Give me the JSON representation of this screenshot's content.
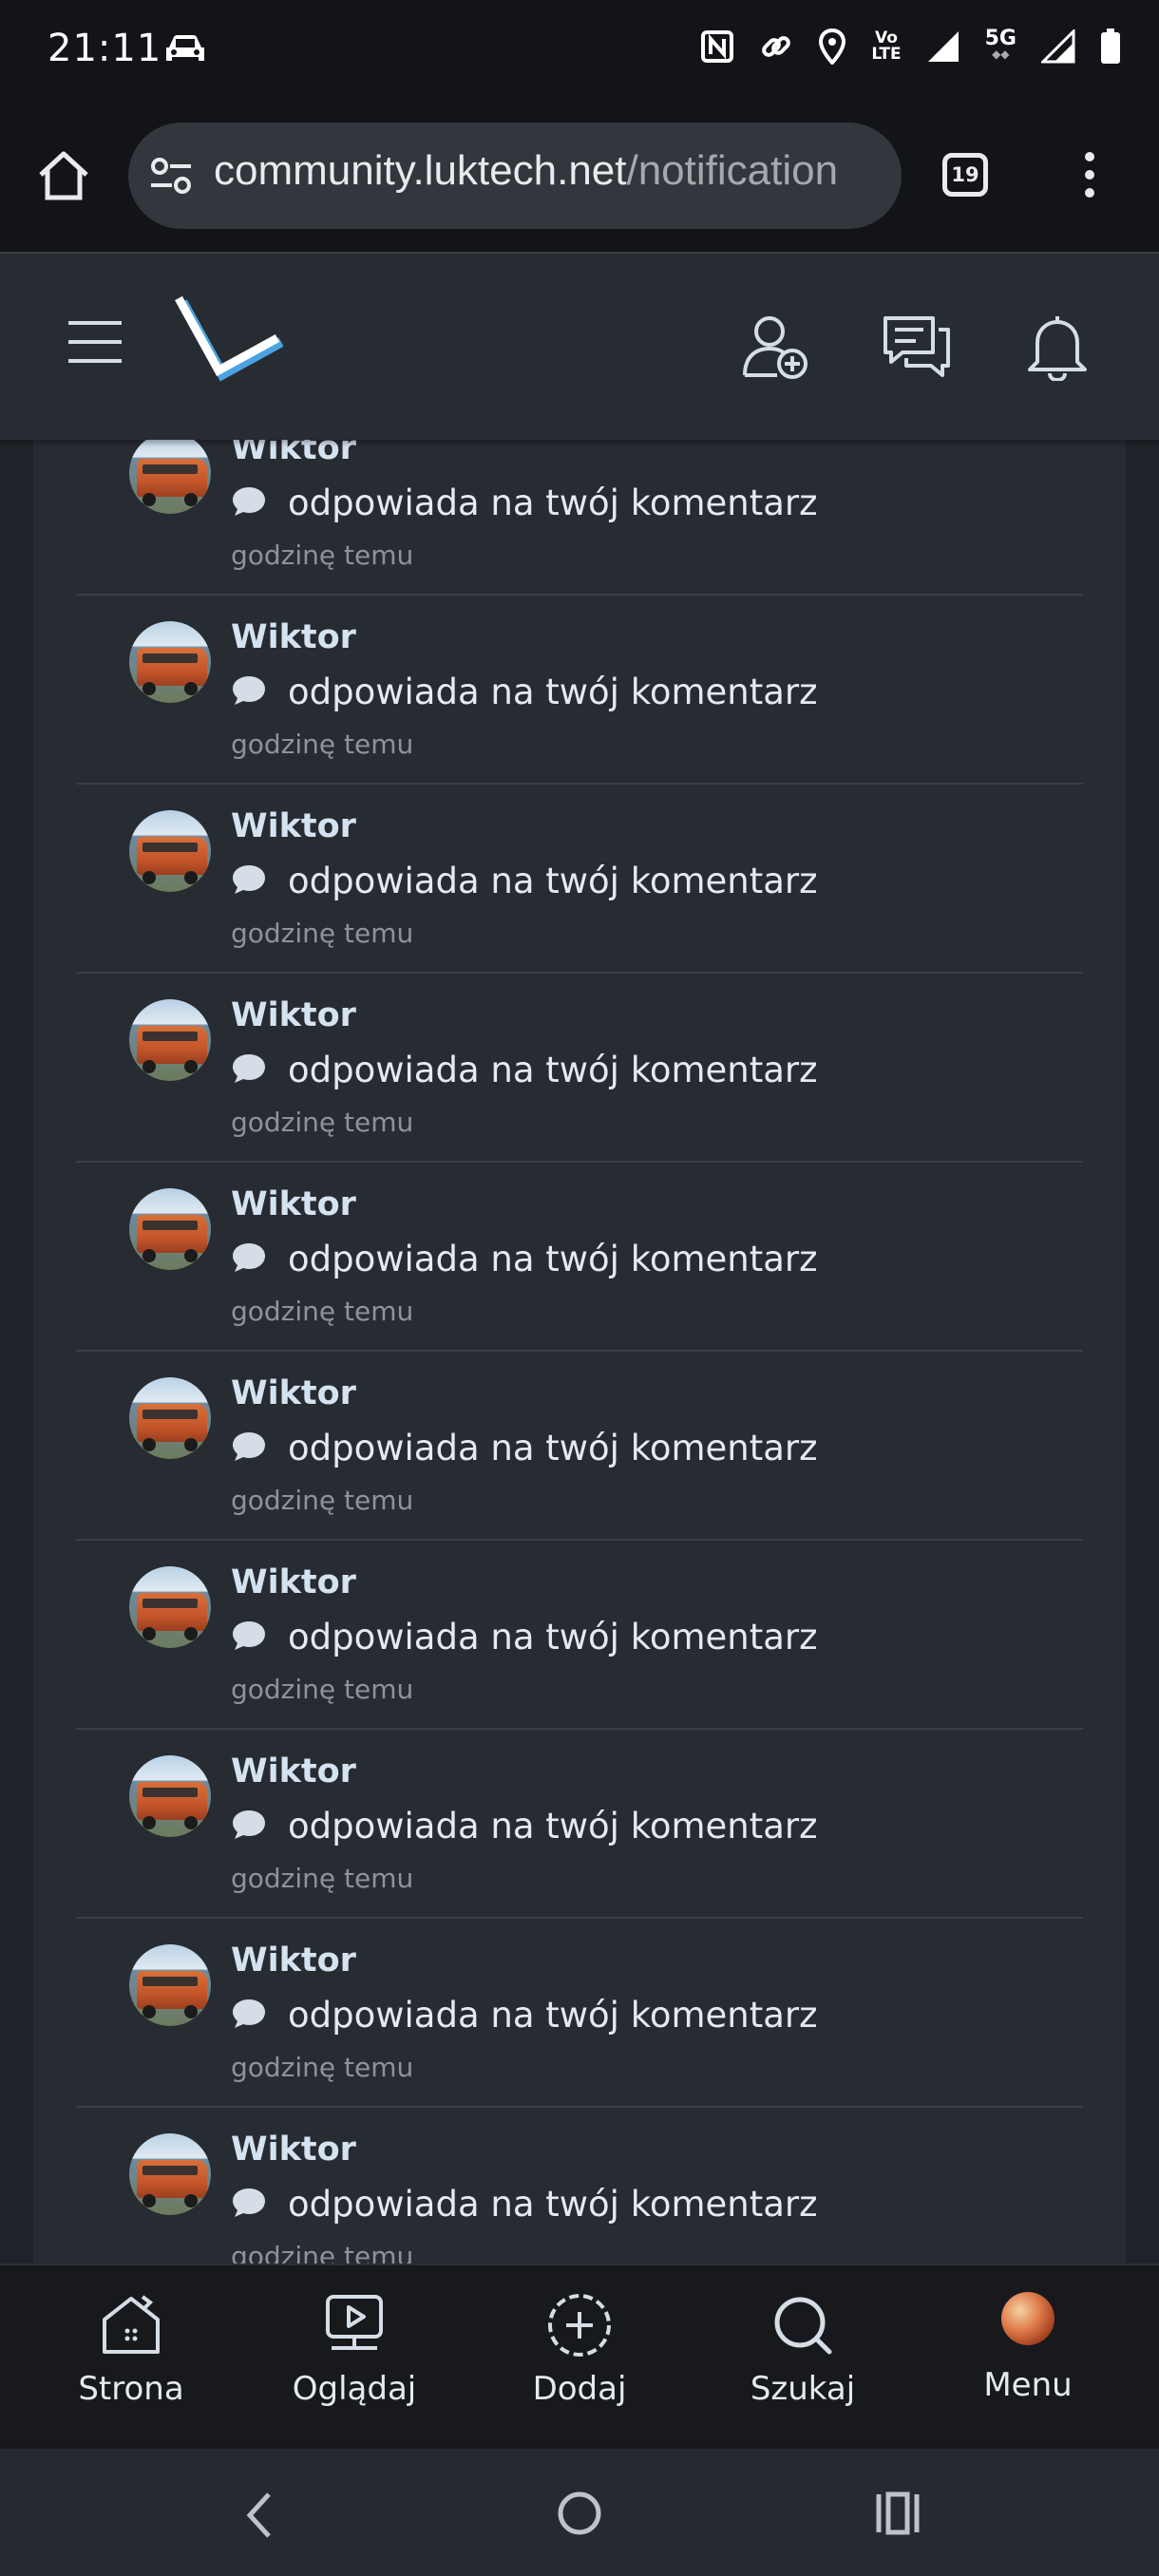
{
  "status_bar": {
    "time": "21:11",
    "network_label": "5G",
    "volte_label_top": "Vo",
    "volte_label_bottom": "LTE",
    "icons": [
      "car-icon",
      "nfc-icon",
      "link-icon",
      "location-icon",
      "volte-icon",
      "signal-icon",
      "battery-icon"
    ]
  },
  "browser": {
    "url_host": "community.luktech.net",
    "url_path": "/notification",
    "tab_count": "19"
  },
  "site_header": {
    "logo_letter": "L",
    "icons": [
      "hamburger-icon",
      "add-friend-icon",
      "messages-icon",
      "bell-icon"
    ]
  },
  "notifications": [
    {
      "user": "Wiktor",
      "action": "odpowiada na twój komentarz",
      "time": "godzinę temu"
    },
    {
      "user": "Wiktor",
      "action": "odpowiada na twój komentarz",
      "time": "godzinę temu"
    },
    {
      "user": "Wiktor",
      "action": "odpowiada na twój komentarz",
      "time": "godzinę temu"
    },
    {
      "user": "Wiktor",
      "action": "odpowiada na twój komentarz",
      "time": "godzinę temu"
    },
    {
      "user": "Wiktor",
      "action": "odpowiada na twój komentarz",
      "time": "godzinę temu"
    },
    {
      "user": "Wiktor",
      "action": "odpowiada na twój komentarz",
      "time": "godzinę temu"
    },
    {
      "user": "Wiktor",
      "action": "odpowiada na twój komentarz",
      "time": "godzinę temu"
    },
    {
      "user": "Wiktor",
      "action": "odpowiada na twój komentarz",
      "time": "godzinę temu"
    },
    {
      "user": "Wiktor",
      "action": "odpowiada na twój komentarz",
      "time": "godzinę temu"
    },
    {
      "user": "Wiktor",
      "action": "odpowiada na twój komentarz",
      "time": "godzinę temu"
    }
  ],
  "bottom_nav": [
    {
      "label": "Strona",
      "icon": "home-icon"
    },
    {
      "label": "Oglądaj",
      "icon": "watch-icon"
    },
    {
      "label": "Dodaj",
      "icon": "add-icon"
    },
    {
      "label": "Szukaj",
      "icon": "search-icon"
    },
    {
      "label": "Menu",
      "icon": "menu-avatar"
    }
  ],
  "colors": {
    "header_bg": "#272b32",
    "page_bg": "#1f2329",
    "username": "#d5e3f0",
    "timestamp": "#8e939a",
    "logo_accent": "#4aa3e0"
  }
}
